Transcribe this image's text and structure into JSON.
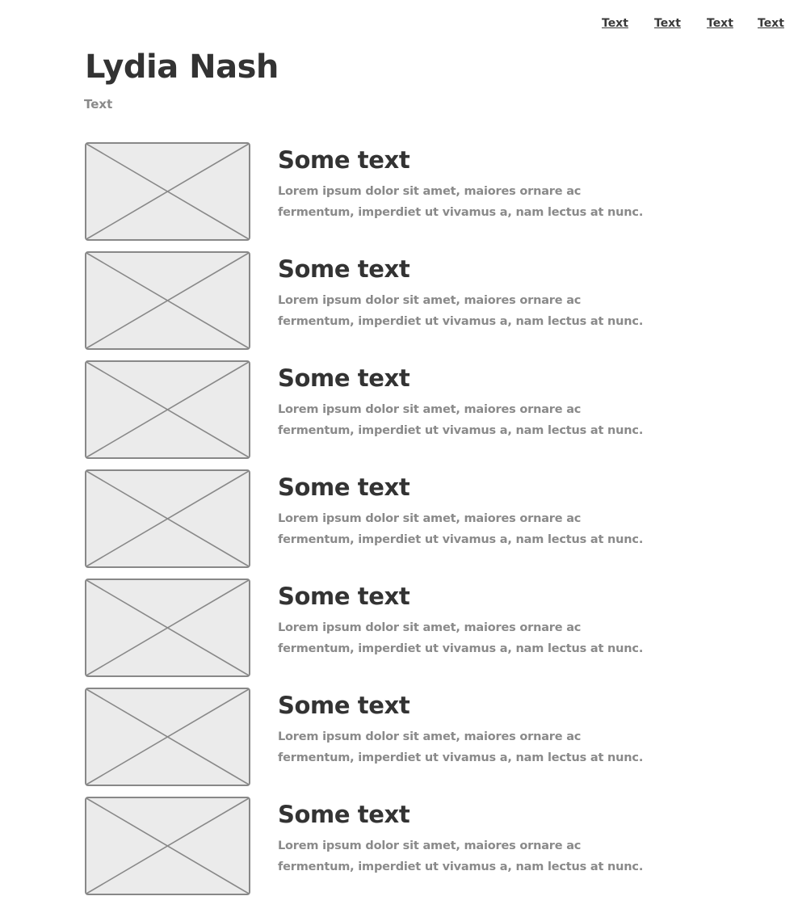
{
  "nav": {
    "links": [
      "Text",
      "Text",
      "Text",
      "Text"
    ]
  },
  "header": {
    "title": "Lydia Nash",
    "subtitle": "Text"
  },
  "items": [
    {
      "title": "Some text",
      "description": "Lorem ipsum dolor sit amet, maiores ornare ac fermentum, imperdiet ut vivamus a, nam lectus at nunc."
    },
    {
      "title": "Some text",
      "description": "Lorem ipsum dolor sit amet, maiores ornare ac fermentum, imperdiet ut vivamus a, nam lectus at nunc."
    },
    {
      "title": "Some text",
      "description": "Lorem ipsum dolor sit amet, maiores ornare ac fermentum, imperdiet ut vivamus a, nam lectus at nunc."
    },
    {
      "title": "Some text",
      "description": "Lorem ipsum dolor sit amet, maiores ornare ac fermentum, imperdiet ut vivamus a, nam lectus at nunc."
    },
    {
      "title": "Some text",
      "description": "Lorem ipsum dolor sit amet, maiores ornare ac fermentum, imperdiet ut vivamus a, nam lectus at nunc."
    },
    {
      "title": "Some text",
      "description": "Lorem ipsum dolor sit amet, maiores ornare ac fermentum, imperdiet ut vivamus a, nam lectus at nunc."
    },
    {
      "title": "Some text",
      "description": "Lorem ipsum dolor sit amet, maiores ornare ac fermentum, imperdiet ut vivamus a, nam lectus at nunc."
    }
  ],
  "colors": {
    "heading": "#333333",
    "muted_text": "#8a8a8a",
    "placeholder_fill": "#ebebeb",
    "placeholder_stroke": "#888888"
  },
  "icons": {
    "image_placeholder": "image-placeholder-icon"
  }
}
